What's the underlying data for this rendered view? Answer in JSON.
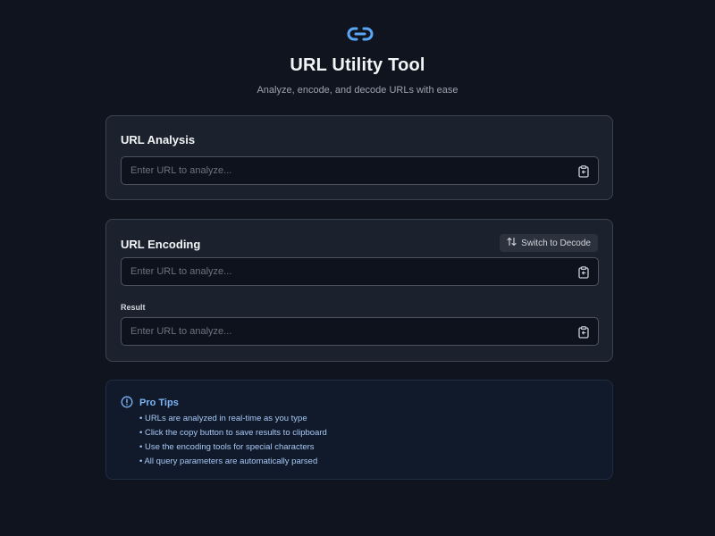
{
  "header": {
    "logo_icon": "link-icon",
    "title": "URL Utility Tool",
    "subtitle": "Analyze, encode, and decode URLs with ease"
  },
  "analysis": {
    "title": "URL Analysis",
    "input_placeholder": "Enter URL to analyze...",
    "input_value": "",
    "copy_icon": "clipboard-icon"
  },
  "encoding": {
    "title": "URL Encoding",
    "switch_label": "Switch to Decode",
    "switch_icon": "swap-vertical-icon",
    "input_placeholder": "Enter URL to analyze...",
    "input_value": "",
    "result_label": "Result",
    "result_placeholder": "Enter URL to analyze...",
    "result_value": "",
    "copy_icon": "clipboard-icon"
  },
  "tips": {
    "icon": "info-icon",
    "title": "Pro Tips",
    "items": [
      "• URLs are analyzed in real-time as you type",
      "• Click the copy button to save results to clipboard",
      "• Use the encoding tools for special characters",
      "• All query parameters are automatically parsed"
    ]
  },
  "colors": {
    "background": "#0f141f",
    "card": "#1b222d",
    "accent": "#60a5fa",
    "tips_text": "#a7c8f5"
  }
}
